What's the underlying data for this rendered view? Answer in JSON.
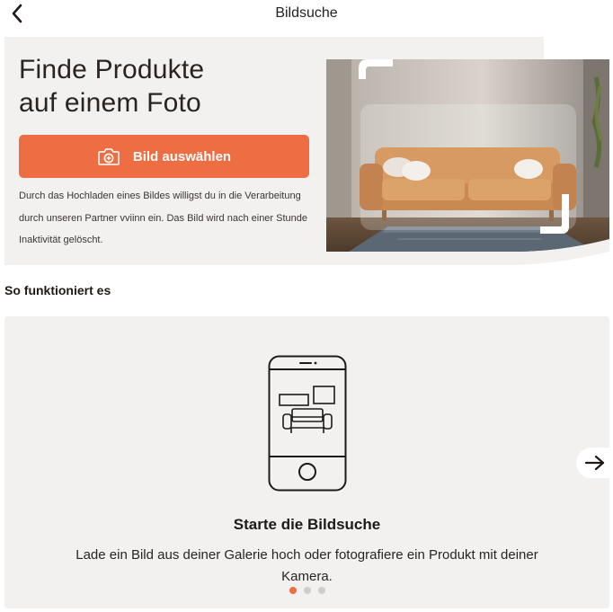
{
  "header": {
    "title": "Bildsuche",
    "back_icon": "chevron-left-icon"
  },
  "hero": {
    "title_line1": "Finde Produkte",
    "title_line2": "auf einem Foto",
    "cta_label": "Bild auswählen",
    "cta_icon": "camera-plus-icon",
    "disclaimer": "Durch das Hochladen eines Bildes willigst du in die Verarbeitung durch unseren Partner vviinn ein. Das Bild wird nach einer Stunde Inaktivität gelöscht."
  },
  "how_it_works": {
    "title": "So funktioniert es",
    "steps": [
      {
        "title": "Starte die Bildsuche",
        "description": "Lade ein Bild aus deiner Galerie hoch oder fotografiere ein Produkt mit deiner Kamera."
      }
    ],
    "active_step": 1,
    "total_steps": 3,
    "next_icon": "arrow-right-icon"
  },
  "colors": {
    "accent": "#ee6e43",
    "panel": "#f2f1f0",
    "text": "#1f1a17"
  }
}
